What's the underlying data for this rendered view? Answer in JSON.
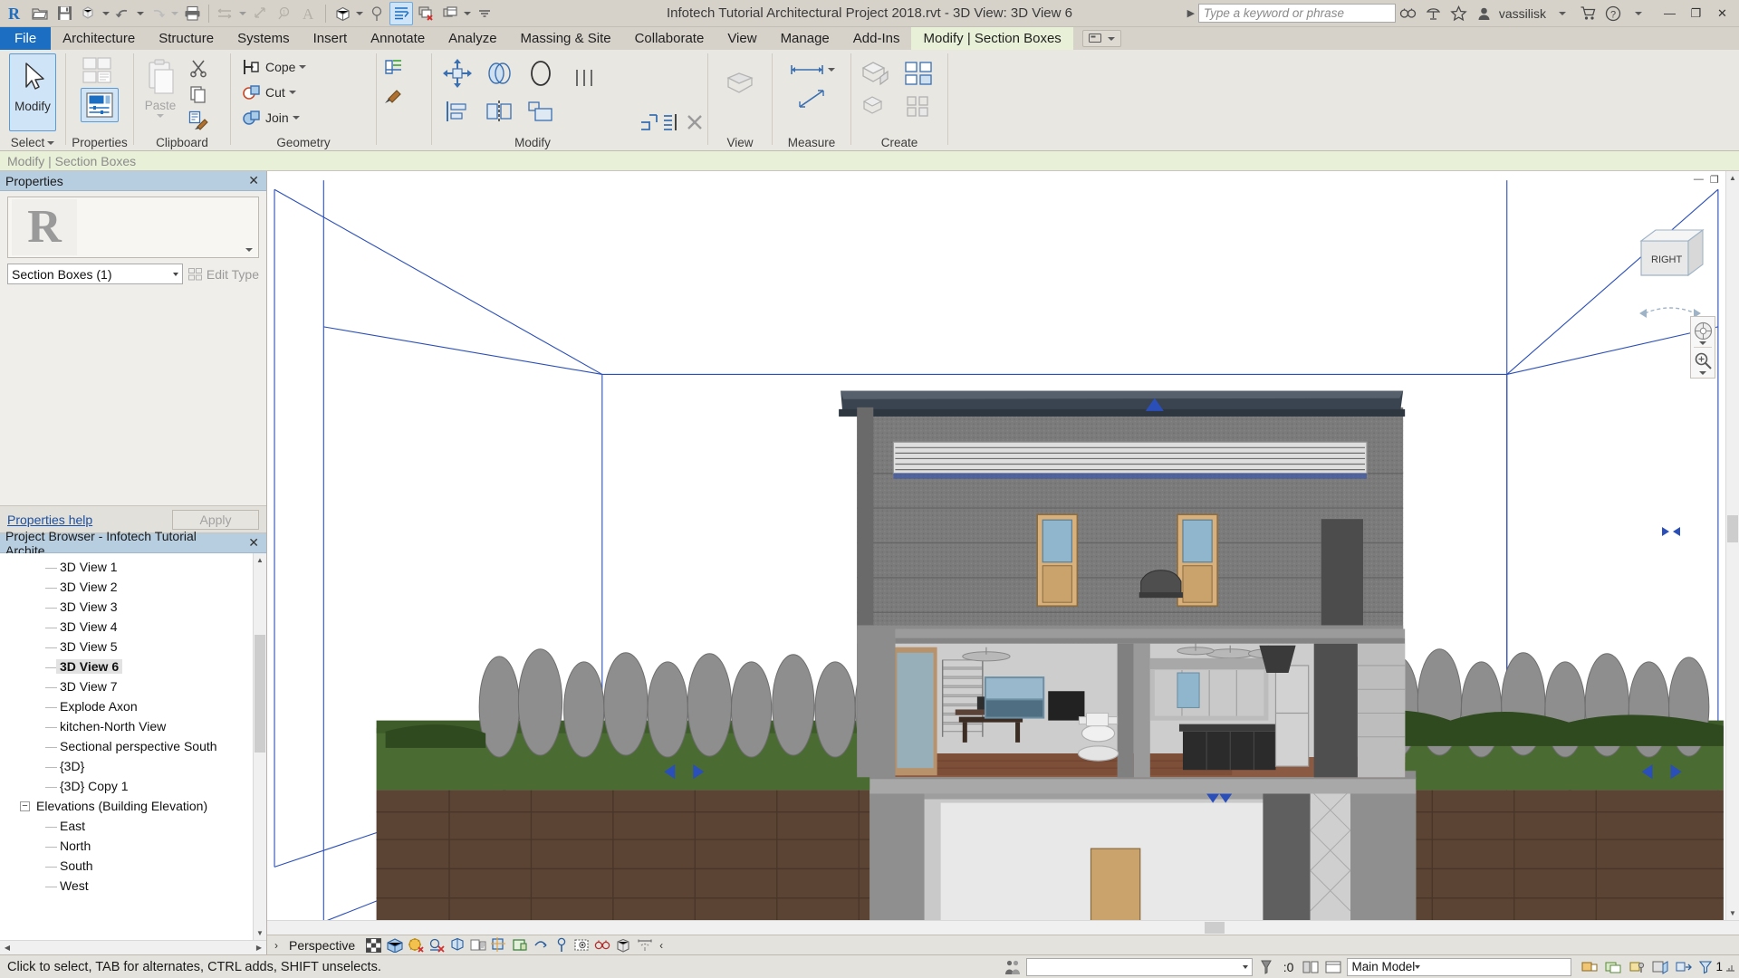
{
  "app": {
    "title": "Infotech Tutorial Architectural Project 2018.rvt - 3D View: 3D View 6",
    "user": "vassilisk"
  },
  "quick_access": {
    "items": [
      {
        "name": "app-menu-r",
        "label": "R"
      },
      {
        "name": "open-icon",
        "label": "Open"
      },
      {
        "name": "save-icon",
        "label": "Save"
      },
      {
        "name": "sync-with-central-icon",
        "label": "Sync"
      },
      {
        "name": "undo-icon",
        "label": "Undo"
      },
      {
        "name": "redo-icon",
        "label": "Redo"
      },
      {
        "name": "print-icon",
        "label": "Print"
      },
      {
        "name": "measure-icon",
        "label": "Measure"
      },
      {
        "name": "aligned-dimension-icon",
        "label": "Aligned Dimension"
      },
      {
        "name": "tag-icon",
        "label": "Tag by Category"
      },
      {
        "name": "text-icon",
        "label": "Text"
      },
      {
        "name": "default-3d-view-icon",
        "label": "Default 3D View"
      },
      {
        "name": "section-icon",
        "label": "Section"
      },
      {
        "name": "thin-lines-icon",
        "label": "Thin Lines"
      },
      {
        "name": "close-hidden-windows-icon",
        "label": "Close Hidden Windows"
      },
      {
        "name": "switch-windows-icon",
        "label": "Switch Windows"
      },
      {
        "name": "customize-qat-icon",
        "label": "Customize Quick Access Toolbar"
      }
    ]
  },
  "search": {
    "placeholder": "Type a keyword or phrase"
  },
  "title_icons": [
    {
      "name": "infocenter-search-icon",
      "label": "Search"
    },
    {
      "name": "subscription-center-icon",
      "label": "Subscription Center"
    },
    {
      "name": "favorites-star-icon",
      "label": "Favorites"
    }
  ],
  "help_icons": [
    {
      "name": "shopping-cart-icon",
      "label": "Autodesk App Store"
    },
    {
      "name": "help-icon",
      "label": "Help"
    }
  ],
  "window_buttons": [
    {
      "name": "minimize-button",
      "label": "—"
    },
    {
      "name": "restore-button",
      "label": "❐"
    },
    {
      "name": "close-button",
      "label": "✕"
    }
  ],
  "ribbon": {
    "tabs": [
      {
        "name": "tab-file",
        "label": "File",
        "style": "file"
      },
      {
        "name": "tab-architecture",
        "label": "Architecture",
        "style": "normal"
      },
      {
        "name": "tab-structure",
        "label": "Structure",
        "style": "normal"
      },
      {
        "name": "tab-systems",
        "label": "Systems",
        "style": "normal"
      },
      {
        "name": "tab-insert",
        "label": "Insert",
        "style": "normal"
      },
      {
        "name": "tab-annotate",
        "label": "Annotate",
        "style": "normal"
      },
      {
        "name": "tab-analyze",
        "label": "Analyze",
        "style": "normal"
      },
      {
        "name": "tab-massing-site",
        "label": "Massing & Site",
        "style": "normal"
      },
      {
        "name": "tab-collaborate",
        "label": "Collaborate",
        "style": "normal"
      },
      {
        "name": "tab-view",
        "label": "View",
        "style": "normal"
      },
      {
        "name": "tab-manage",
        "label": "Manage",
        "style": "normal"
      },
      {
        "name": "tab-addins",
        "label": "Add-Ins",
        "style": "normal"
      },
      {
        "name": "tab-modify-section-boxes",
        "label": "Modify | Section Boxes",
        "style": "context"
      }
    ],
    "panels": [
      {
        "name": "panel-select",
        "label": "Select"
      },
      {
        "name": "panel-properties",
        "label": "Properties"
      },
      {
        "name": "panel-clipboard",
        "label": "Clipboard"
      },
      {
        "name": "panel-geometry",
        "label": "Geometry"
      },
      {
        "name": "panel-modify",
        "label": "Modify"
      },
      {
        "name": "panel-view",
        "label": "View"
      },
      {
        "name": "panel-measure",
        "label": "Measure"
      },
      {
        "name": "panel-create",
        "label": "Create"
      }
    ],
    "modify_button": "Modify",
    "paste_button": "Paste",
    "geometry": {
      "cope": "Cope",
      "cut": "Cut",
      "join": "Join"
    }
  },
  "context_bar": {
    "label": "Modify | Section Boxes"
  },
  "properties": {
    "title": "Properties",
    "close": "✕",
    "type_selector": "R",
    "instance": "Section Boxes (1)",
    "edit_type": "Edit Type",
    "help_link": "Properties help",
    "apply": "Apply"
  },
  "project_browser": {
    "title": "Project Browser - Infotech Tutorial Archite...",
    "close": "✕",
    "nodes": [
      {
        "name": "tree-item-3d-view-1",
        "label": "3D View 1",
        "indent": 3,
        "type": "leaf",
        "selected": false
      },
      {
        "name": "tree-item-3d-view-2",
        "label": "3D View 2",
        "indent": 3,
        "type": "leaf",
        "selected": false
      },
      {
        "name": "tree-item-3d-view-3",
        "label": "3D View 3",
        "indent": 3,
        "type": "leaf",
        "selected": false
      },
      {
        "name": "tree-item-3d-view-4",
        "label": "3D View 4",
        "indent": 3,
        "type": "leaf",
        "selected": false
      },
      {
        "name": "tree-item-3d-view-5",
        "label": "3D View 5",
        "indent": 3,
        "type": "leaf",
        "selected": false
      },
      {
        "name": "tree-item-3d-view-6",
        "label": "3D View 6",
        "indent": 3,
        "type": "leaf",
        "selected": true
      },
      {
        "name": "tree-item-3d-view-7",
        "label": "3D View 7",
        "indent": 3,
        "type": "leaf",
        "selected": false
      },
      {
        "name": "tree-item-explode-axon",
        "label": "Explode Axon",
        "indent": 3,
        "type": "leaf",
        "selected": false
      },
      {
        "name": "tree-item-kitchen-north-view",
        "label": "kitchen-North View",
        "indent": 3,
        "type": "leaf",
        "selected": false
      },
      {
        "name": "tree-item-sectional-perspective-south",
        "label": "Sectional perspective South",
        "indent": 3,
        "type": "leaf",
        "selected": false
      },
      {
        "name": "tree-item-3d-brace",
        "label": "{3D}",
        "indent": 3,
        "type": "leaf",
        "selected": false
      },
      {
        "name": "tree-item-3d-copy-1",
        "label": "{3D} Copy 1",
        "indent": 3,
        "type": "leaf",
        "selected": false
      },
      {
        "name": "tree-item-elevations",
        "label": "Elevations (Building Elevation)",
        "indent": 1,
        "type": "group",
        "selected": false
      },
      {
        "name": "tree-item-east",
        "label": "East",
        "indent": 3,
        "type": "leaf",
        "selected": false
      },
      {
        "name": "tree-item-north",
        "label": "North",
        "indent": 3,
        "type": "leaf",
        "selected": false
      },
      {
        "name": "tree-item-south",
        "label": "South",
        "indent": 3,
        "type": "leaf",
        "selected": false
      },
      {
        "name": "tree-item-west",
        "label": "West",
        "indent": 3,
        "type": "leaf",
        "selected": false
      }
    ]
  },
  "view": {
    "cube_label": "RIGHT",
    "control_bar": {
      "label": "Perspective",
      "icons": [
        {
          "name": "view-scale-icon",
          "label": "View Scale"
        },
        {
          "name": "detail-level-icon",
          "label": "Detail Level"
        },
        {
          "name": "visual-style-icon",
          "label": "Visual Style"
        },
        {
          "name": "sun-path-icon",
          "label": "Sun Path Off"
        },
        {
          "name": "shadows-off-icon",
          "label": "Shadows Off"
        },
        {
          "name": "rendering-dialog-icon",
          "label": "Show Rendering Dialog"
        },
        {
          "name": "crop-view-icon",
          "label": "Crop View"
        },
        {
          "name": "show-crop-region-icon",
          "label": "Show Crop Region"
        },
        {
          "name": "lock-3d-view-icon",
          "label": "Lock 3D View"
        },
        {
          "name": "temporary-hide-isolate-icon",
          "label": "Temporary Hide/Isolate"
        },
        {
          "name": "reveal-hidden-elements-icon",
          "label": "Reveal Hidden Elements"
        },
        {
          "name": "worksharing-display-icon",
          "label": "Worksharing Display"
        },
        {
          "name": "temporary-view-properties-icon",
          "label": "Temporary View Properties"
        },
        {
          "name": "analytical-model-icon",
          "label": "Show Analytical Model"
        },
        {
          "name": "constraints-icon",
          "label": "Reveal Constraints"
        }
      ],
      "collapse": "‹"
    },
    "panel_icons": {
      "minimize": "—",
      "restore": "❐",
      "close": "✕"
    }
  },
  "status_bar": {
    "message": "Click to select, TAB for alternates, CTRL adds, SHIFT unselects.",
    "selection_combo": "",
    "count": ":0",
    "model": "Main Model",
    "filter_count": "1",
    "right_icons": [
      {
        "name": "design-options-icon",
        "label": "Design Options"
      },
      {
        "name": "exclude-options-icon",
        "label": "Exclude Options"
      },
      {
        "name": "editable-only-icon",
        "label": "Editable Only"
      },
      {
        "name": "worksets-icon",
        "label": "Worksets"
      },
      {
        "name": "select-links-icon",
        "label": "Select Links"
      },
      {
        "name": "select-underlay-icon",
        "label": "Select Underlay Elements"
      },
      {
        "name": "select-pinned-icon",
        "label": "Select Pinned Elements"
      },
      {
        "name": "select-by-face-icon",
        "label": "Select Elements by Face"
      },
      {
        "name": "drag-elements-icon",
        "label": "Drag Elements on Selection"
      },
      {
        "name": "filter-icon",
        "label": "Filter"
      }
    ]
  }
}
